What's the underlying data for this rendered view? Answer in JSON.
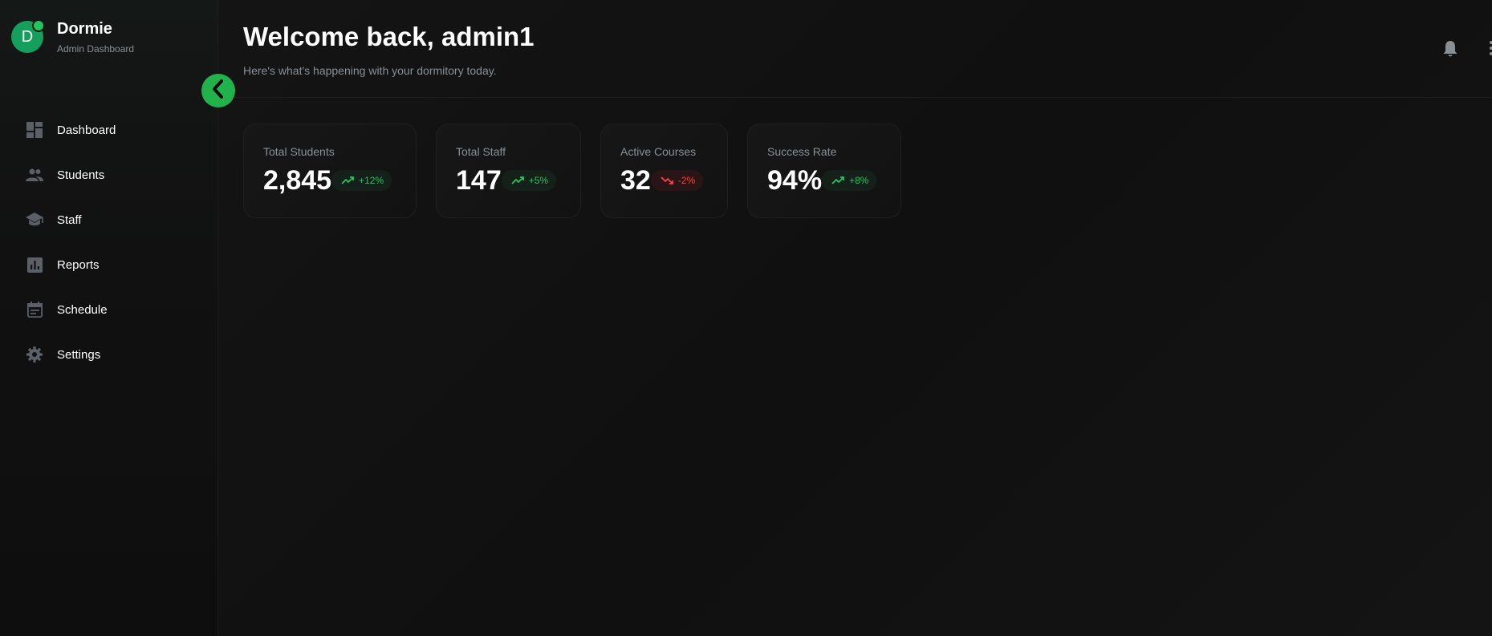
{
  "colors": {
    "accent": "#22c55e",
    "brand_avatar": "#14a05c",
    "collapse_button": "#22b24c",
    "negative": "#ef4444",
    "muted_text": "#8a8f94"
  },
  "brand": {
    "initial": "D",
    "name": "Dormie",
    "subtitle": "Admin Dashboard"
  },
  "sidebar": {
    "items": [
      {
        "label": "Dashboard",
        "icon": "dashboard-icon"
      },
      {
        "label": "Students",
        "icon": "people-icon"
      },
      {
        "label": "Staff",
        "icon": "graduation-cap-icon"
      },
      {
        "label": "Reports",
        "icon": "bar-chart-icon"
      },
      {
        "label": "Schedule",
        "icon": "calendar-icon"
      },
      {
        "label": "Settings",
        "icon": "gear-icon"
      }
    ],
    "collapse_icon": "chevron-left-icon"
  },
  "header": {
    "title": "Welcome back, admin1",
    "subtitle": "Here's what's happening with your dormitory today.",
    "icons": [
      "bell-icon",
      "kebab-menu-icon"
    ]
  },
  "stats": [
    {
      "label": "Total Students",
      "value": "2,845",
      "trend": "+12%",
      "direction": "up"
    },
    {
      "label": "Total Staff",
      "value": "147",
      "trend": "+5%",
      "direction": "up"
    },
    {
      "label": "Active Courses",
      "value": "32",
      "trend": "-2%",
      "direction": "down"
    },
    {
      "label": "Success Rate",
      "value": "94%",
      "trend": "+8%",
      "direction": "up"
    }
  ]
}
